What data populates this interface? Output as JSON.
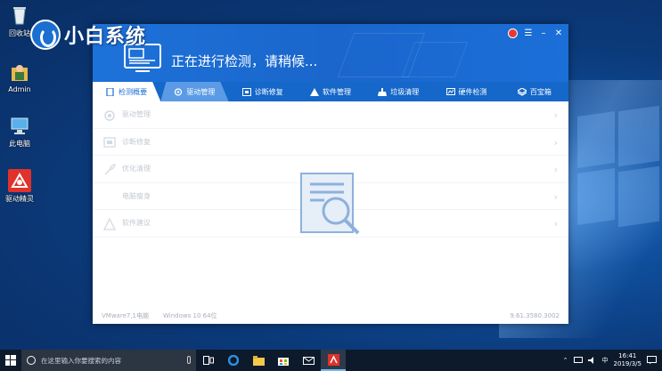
{
  "desktop": {
    "icons": [
      {
        "label": "回收站",
        "icon": "recycle-bin-icon"
      },
      {
        "label": "Admin",
        "icon": "user-folder-icon"
      },
      {
        "label": "此电脑",
        "icon": "computer-icon"
      },
      {
        "label": "驱动精灵",
        "icon": "driver-genius-icon"
      }
    ]
  },
  "watermark": {
    "text": "小白系统"
  },
  "app": {
    "status": "正在进行检测，请稍候...",
    "controls": {
      "minimize": "–",
      "maximize": "☰",
      "close": "✕"
    },
    "tabs": [
      {
        "label": "检测概要",
        "icon": "overview-icon"
      },
      {
        "label": "驱动管理",
        "icon": "gear-icon"
      },
      {
        "label": "诊断修复",
        "icon": "repair-icon"
      },
      {
        "label": "软件管理",
        "icon": "software-icon"
      },
      {
        "label": "垃圾清理",
        "icon": "broom-icon"
      },
      {
        "label": "硬件检测",
        "icon": "hardware-icon"
      },
      {
        "label": "百宝箱",
        "icon": "toolbox-icon"
      }
    ],
    "rows": [
      {
        "label": "驱动管理",
        "icon": "gear-icon"
      },
      {
        "label": "诊断修复",
        "icon": "repair-icon"
      },
      {
        "label": "优化清理",
        "icon": "rocket-icon"
      },
      {
        "label": "电脑瘦身",
        "icon": ""
      },
      {
        "label": "软件建议",
        "icon": "software-icon"
      }
    ],
    "footer": {
      "machine": "VMware7,1电脑",
      "os": "Windows 10 64位",
      "version": "9.61.3580.3002"
    }
  },
  "taskbar": {
    "search_placeholder": "在这里输入你要搜索的内容",
    "ime": "中",
    "time": "16:41",
    "date": "2019/3/5"
  },
  "colors": {
    "header_blue": "#1d72d9",
    "tab_bar": "#1567c9",
    "accent": "#1d6fd6",
    "taskbar": "#0c1a2c"
  }
}
